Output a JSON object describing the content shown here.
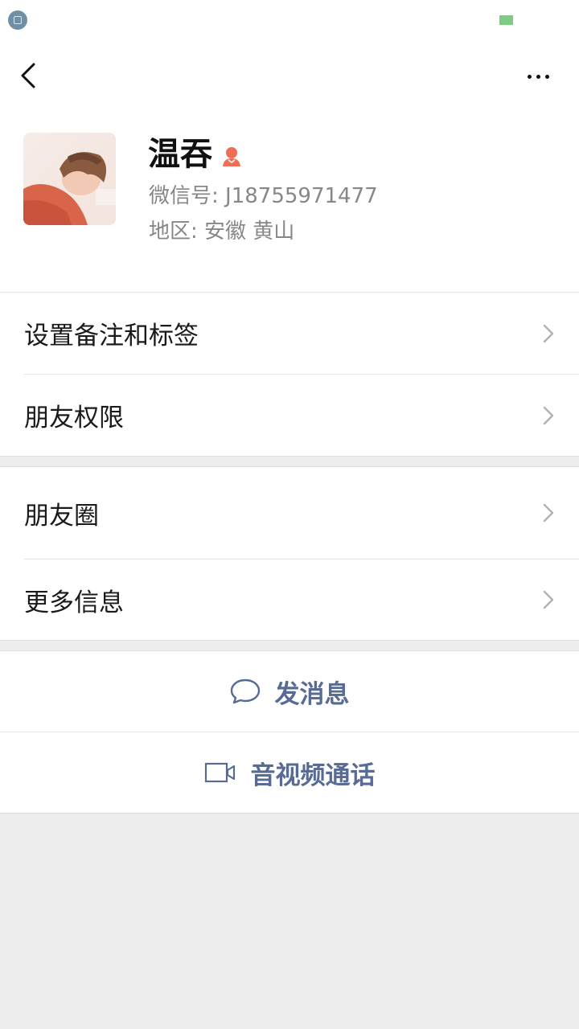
{
  "profile": {
    "name": "温吞",
    "wechat_id_line": "微信号:  J18755971477",
    "region_line": "地区:  安徽  黄山"
  },
  "menu_group_1": [
    {
      "label": "设置备注和标签"
    },
    {
      "label": "朋友权限"
    }
  ],
  "menu_group_2": [
    {
      "label": "朋友圈"
    },
    {
      "label": "更多信息"
    }
  ],
  "actions": {
    "send_message": "发消息",
    "video_call": "音视频通话"
  },
  "icons": {
    "back": "chevron-left-icon",
    "more": "more-dots-icon",
    "gender": "female-icon",
    "chat": "chat-bubble-icon",
    "video": "video-camera-icon",
    "chevron": "chevron-right-icon"
  },
  "colors": {
    "accent_link": "#576b95",
    "gender_female": "#f06e55",
    "background": "#ededed",
    "battery": "#7ccd82"
  }
}
